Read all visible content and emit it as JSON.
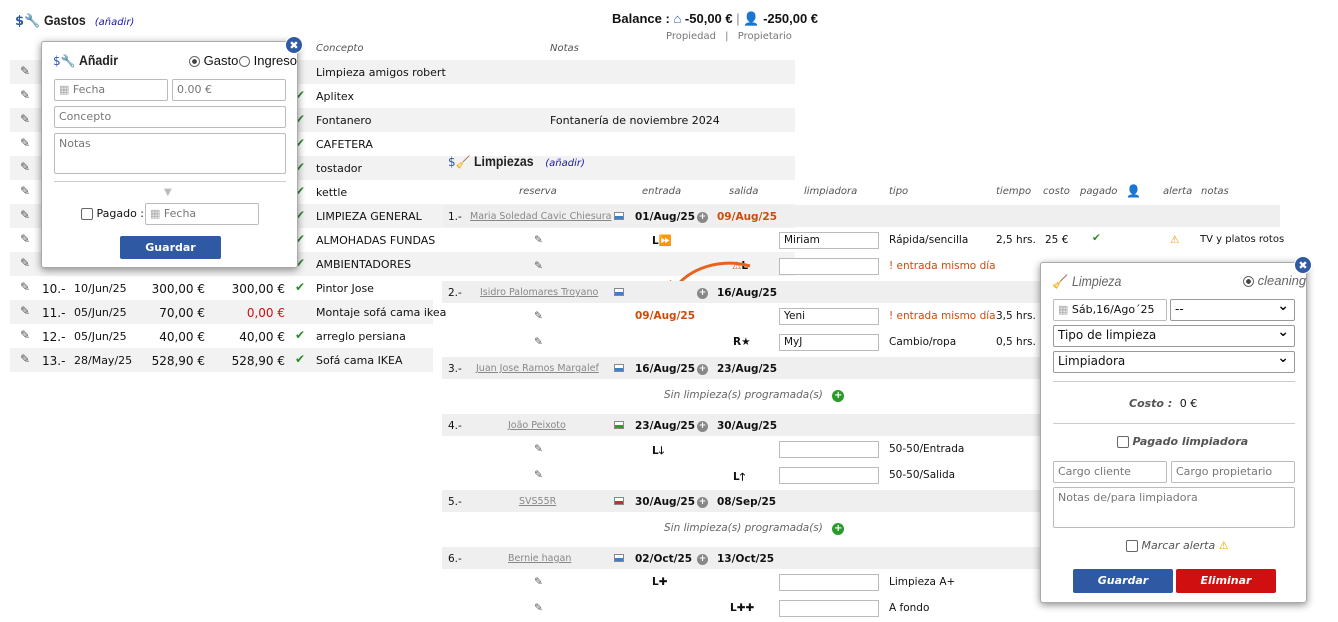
{
  "gastos": {
    "title": "Gastos",
    "add_link": "(añadir)",
    "col_concepto": "Concepto",
    "col_notas": "Notas",
    "rows_partial": [
      {
        "concepto": "Limpieza amigos robert",
        "notas": ""
      },
      {
        "concepto": "Aplitex",
        "notas": ""
      },
      {
        "concepto": "Fontanero",
        "notas": "Fontanería de noviembre 2024"
      },
      {
        "concepto": "CAFETERA",
        "notas": ""
      },
      {
        "concepto": "tostador",
        "notas": ""
      },
      {
        "concepto": "kettle",
        "notas": ""
      },
      {
        "concepto": "LIMPIEZA GENERAL",
        "notas": ""
      },
      {
        "concepto": "ALMOHADAS FUNDAS",
        "notas": ""
      },
      {
        "concepto": "AMBIENTADORES",
        "notas": ""
      }
    ],
    "rows_full": [
      {
        "num": "10.-",
        "fecha": "10/Jun/25",
        "importe": "300,00 €",
        "pagado": "300,00 €",
        "concepto": "Pintor Jose"
      },
      {
        "num": "11.-",
        "fecha": "05/Jun/25",
        "importe": "70,00 €",
        "pagado": "0,00 €",
        "concepto": "Montaje sofá cama ikea"
      },
      {
        "num": "12.-",
        "fecha": "05/Jun/25",
        "importe": "40,00 €",
        "pagado": "40,00 €",
        "concepto": "arreglo persiana"
      },
      {
        "num": "13.-",
        "fecha": "28/May/25",
        "importe": "528,90 €",
        "pagado": "528,90 €",
        "concepto": "Sofá cama IKEA"
      }
    ]
  },
  "balance": {
    "label": "Balance :",
    "propiedad_value": "-50,00 €",
    "propietario_value": "-250,00 €",
    "sep": "|",
    "propiedad_label": "Propiedad",
    "propietario_label": "Propietario"
  },
  "anadir_popup": {
    "title": "Añadir",
    "radio_gasto": "Gasto",
    "radio_ingreso": "Ingreso",
    "fecha_placeholder": "Fecha",
    "amount_placeholder": "0.00 €",
    "concepto_placeholder": "Concepto",
    "notas_placeholder": "Notas",
    "pagado_label": "Pagado :",
    "pagado_fecha_placeholder": "Fecha",
    "save_button": "Guardar"
  },
  "limpiezas": {
    "title": "Limpiezas",
    "add_link": "(añadir)",
    "headers": {
      "reserva": "reserva",
      "entrada": "entrada",
      "salida": "salida",
      "limpiadora": "limpiadora",
      "tipo": "tipo",
      "tiempo": "tiempo",
      "costo": "costo",
      "pagado": "pagado",
      "alerta": "alerta",
      "notas": "notas"
    },
    "no_cleanings": "Sin limpieza(s) programada(s)",
    "reservations": [
      {
        "num": "1.-",
        "guest": "Maria Soledad Cavic Chiesura",
        "entrada": "01/Aug/25",
        "salida": "09/Aug/25",
        "color": "#3a7fd0"
      },
      {
        "num": "2.-",
        "guest": "Isidro Palomares Troyano",
        "entrada": "",
        "salida": "16/Aug/25",
        "color": "#3a7fd0"
      },
      {
        "num": "3.-",
        "guest": "Juan Jose Ramos Margalef",
        "entrada": "16/Aug/25",
        "salida": "23/Aug/25",
        "color": "#3a7fd0"
      },
      {
        "num": "4.-",
        "guest": "João Peixoto",
        "entrada": "23/Aug/25",
        "salida": "30/Aug/25",
        "color": "#2aa02a"
      },
      {
        "num": "5.-",
        "guest": "SVS55R",
        "entrada": "30/Aug/25",
        "salida": "08/Sep/25",
        "color": "#c03030"
      },
      {
        "num": "6.-",
        "guest": "Bernie hagan",
        "entrada": "02/Oct/25",
        "salida": "13/Oct/25",
        "color": "#3a7fd0"
      }
    ],
    "cleanings": [
      {
        "icon": "L⏩",
        "limpiadora": "Miriam",
        "tipo": "Rápida/sencilla",
        "tiempo": "2,5 hrs.",
        "costo": "25 €",
        "notas": "TV y platos rotos"
      },
      {
        "icon": "L",
        "limpiadora": "",
        "tipo": "! entrada mismo día"
      },
      {
        "date": "09/Aug/25",
        "limpiadora": "Yeni",
        "tipo": "! entrada mismo día",
        "tiempo": "3,5 hrs."
      },
      {
        "icon": "R★",
        "limpiadora": "MyJ",
        "tipo": "Cambio/ropa",
        "tiempo": "0,5 hrs."
      },
      {
        "icon": "L",
        "limpiadora": "",
        "tipo": "50-50/Entrada"
      },
      {
        "icon": "L",
        "limpiadora": "",
        "tipo": "50-50/Salida"
      },
      {
        "icon": "L",
        "limpiadora": "",
        "tipo": "Limpieza A+"
      },
      {
        "icon": "L",
        "limpiadora": "",
        "tipo": "A fondo"
      }
    ]
  },
  "limpieza_popup": {
    "title": "Limpieza",
    "radio_cleaning": "cleaning",
    "date_value": "Sáb,16/Ago´25",
    "time_value": "--",
    "tipo_select": "Tipo de limpieza",
    "limpiadora_select": "Limpiadora",
    "costo_label": "Costo :",
    "costo_value": "0 €",
    "pagado_label": "Pagado limpiadora",
    "cargo_cliente_placeholder": "Cargo cliente",
    "cargo_propietario_placeholder": "Cargo propietario",
    "notas_placeholder": "Notas de/para limpiadora",
    "marcar_alerta": "Marcar alerta",
    "save_button": "Guardar",
    "delete_button": "Eliminar"
  },
  "colors": {
    "blue_button": "#2f5aa3",
    "red_button": "#d01010",
    "check": "#2a8a2a",
    "orange": "#d04a0a"
  }
}
